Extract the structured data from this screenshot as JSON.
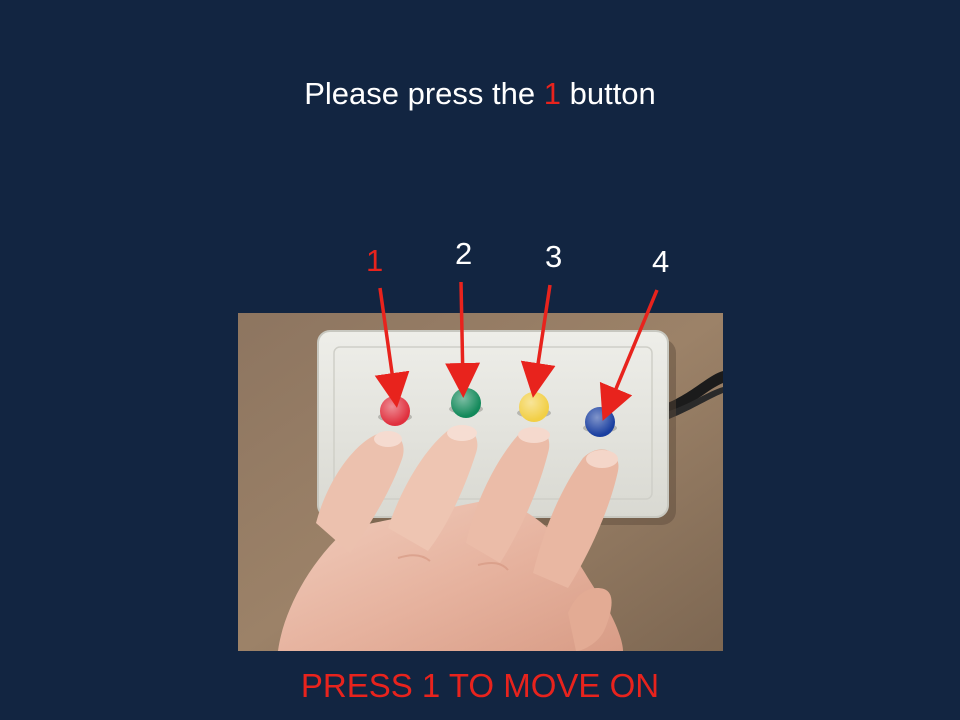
{
  "instruction": {
    "prefix": "Please press the ",
    "button_number": "1",
    "suffix": " button"
  },
  "button_labels": [
    {
      "label": "1",
      "active": true
    },
    {
      "label": "2",
      "active": false
    },
    {
      "label": "3",
      "active": false
    },
    {
      "label": "4",
      "active": false
    }
  ],
  "photo": {
    "button_colors": [
      "#e0303e",
      "#12895a",
      "#f2cf45",
      "#1a3fa0"
    ]
  },
  "footer": {
    "prompt": "PRESS 1 TO MOVE ON"
  },
  "colors": {
    "background": "#122541",
    "highlight": "#e8231d",
    "text": "#ffffff"
  }
}
